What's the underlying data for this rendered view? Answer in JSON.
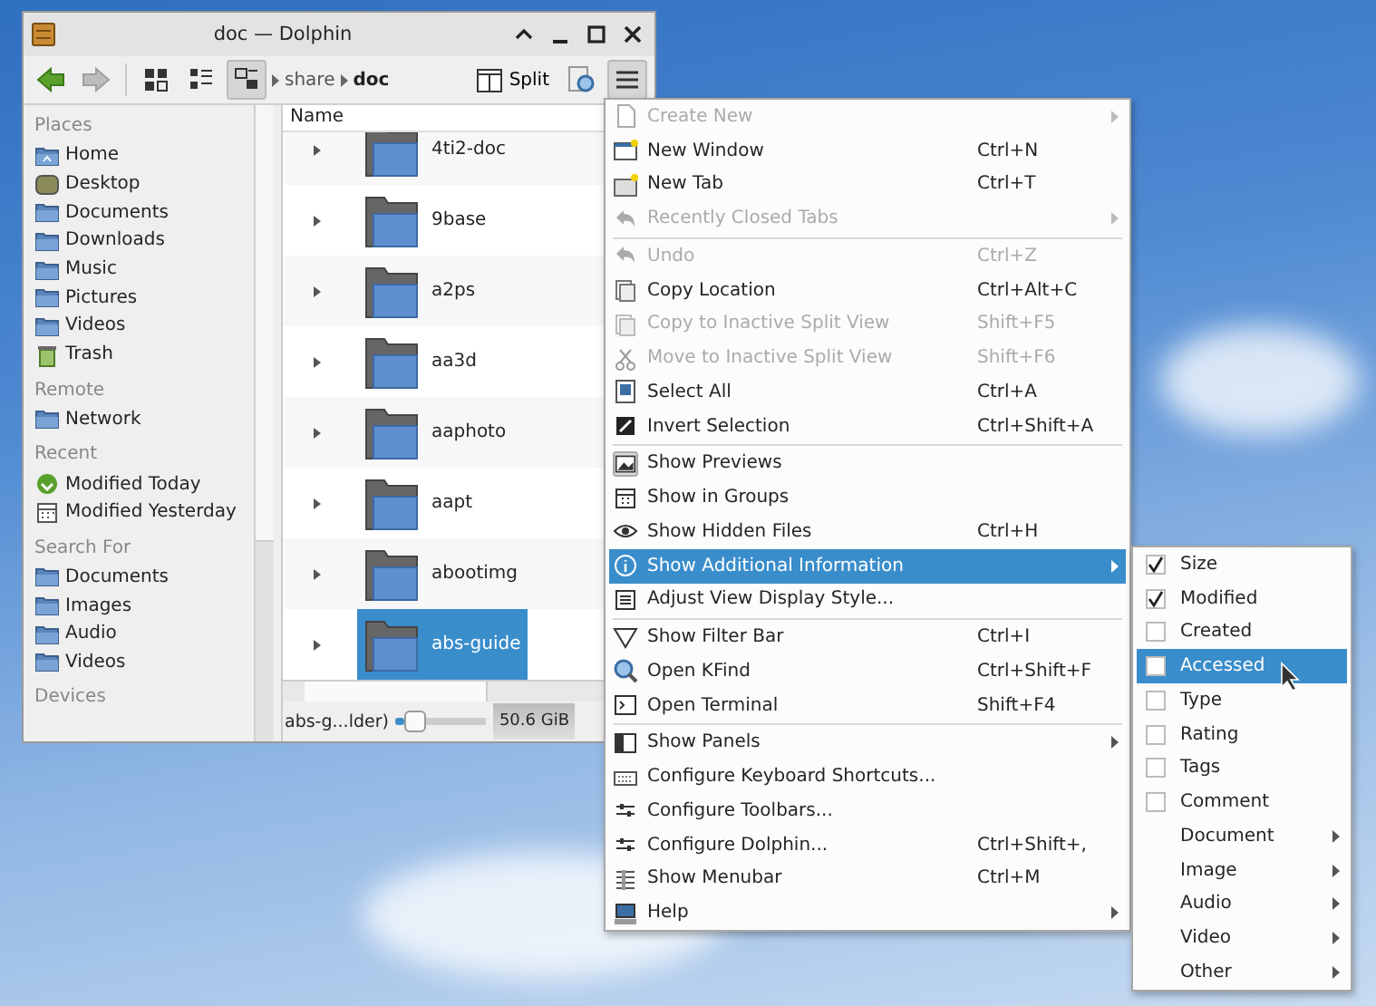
{
  "window": {
    "title": "doc — Dolphin"
  },
  "toolbar": {
    "breadcrumb": [
      {
        "label": "share",
        "current": false
      },
      {
        "label": "doc",
        "current": true
      }
    ],
    "split_button": "Split"
  },
  "sidebar": {
    "sections": [
      {
        "title": "Places",
        "items": [
          "Home",
          "Desktop",
          "Documents",
          "Downloads",
          "Music",
          "Pictures",
          "Videos",
          "Trash"
        ]
      },
      {
        "title": "Remote",
        "items": [
          "Network"
        ]
      },
      {
        "title": "Recent",
        "items": [
          "Modified Today",
          "Modified Yesterday"
        ]
      },
      {
        "title": "Search For",
        "items": [
          "Documents",
          "Images",
          "Audio",
          "Videos"
        ]
      },
      {
        "title": "Devices"
      }
    ]
  },
  "file_view": {
    "column": "Name",
    "rows": [
      {
        "name": "4ti2-doc",
        "selected": false
      },
      {
        "name": "9base",
        "selected": false
      },
      {
        "name": "a2ps",
        "selected": false
      },
      {
        "name": "aa3d",
        "selected": false
      },
      {
        "name": "aaphoto",
        "selected": false
      },
      {
        "name": "aapt",
        "selected": false
      },
      {
        "name": "abootimg",
        "selected": false
      },
      {
        "name": "abs-guide",
        "selected": true
      }
    ]
  },
  "status_bar": {
    "selection": "abs-g...lder)",
    "zoom": {
      "level": 0.1
    },
    "free_space": "50.6 GiB"
  },
  "menu": {
    "items": [
      {
        "kind": "item",
        "label": "Create New",
        "disabled": true,
        "submenu": true,
        "selected": false
      },
      {
        "kind": "item",
        "label": "New Window",
        "shortcut": "Ctrl+N",
        "disabled": false,
        "submenu": false,
        "selected": false
      },
      {
        "kind": "item",
        "label": "New Tab",
        "shortcut": "Ctrl+T",
        "disabled": false,
        "submenu": false,
        "selected": false
      },
      {
        "kind": "item",
        "label": "Recently Closed Tabs",
        "disabled": true,
        "submenu": true,
        "selected": false
      },
      {
        "kind": "separator"
      },
      {
        "kind": "item",
        "label": "Undo",
        "shortcut": "Ctrl+Z",
        "disabled": true,
        "submenu": false,
        "selected": false
      },
      {
        "kind": "item",
        "label": "Copy Location",
        "shortcut": "Ctrl+Alt+C",
        "disabled": false,
        "submenu": false,
        "selected": false
      },
      {
        "kind": "item",
        "label": "Copy to Inactive Split View",
        "shortcut": "Shift+F5",
        "disabled": true,
        "submenu": false,
        "selected": false
      },
      {
        "kind": "item",
        "label": "Move to Inactive Split View",
        "shortcut": "Shift+F6",
        "disabled": true,
        "submenu": false,
        "selected": false
      },
      {
        "kind": "item",
        "label": "Select All",
        "shortcut": "Ctrl+A",
        "disabled": false,
        "submenu": false,
        "selected": false
      },
      {
        "kind": "item",
        "label": "Invert Selection",
        "shortcut": "Ctrl+Shift+A",
        "disabled": false,
        "submenu": false,
        "selected": false
      },
      {
        "kind": "separator"
      },
      {
        "kind": "toggle",
        "label": "Show Previews",
        "checked": true,
        "disabled": false,
        "submenu": false,
        "selected": false
      },
      {
        "kind": "toggle",
        "label": "Show in Groups",
        "checked": false,
        "disabled": false,
        "submenu": false,
        "selected": false
      },
      {
        "kind": "toggle",
        "label": "Show Hidden Files",
        "shortcut": "Ctrl+H",
        "checked": false,
        "disabled": false,
        "submenu": false,
        "selected": false
      },
      {
        "kind": "item",
        "label": "Show Additional Information",
        "disabled": false,
        "submenu": true,
        "selected": true
      },
      {
        "kind": "item",
        "label": "Adjust View Display Style...",
        "disabled": false,
        "submenu": false,
        "selected": false
      },
      {
        "kind": "separator"
      },
      {
        "kind": "item",
        "label": "Show Filter Bar",
        "shortcut": "Ctrl+I",
        "disabled": false,
        "submenu": false,
        "selected": false
      },
      {
        "kind": "item",
        "label": "Open KFind",
        "shortcut": "Ctrl+Shift+F",
        "disabled": false,
        "submenu": false,
        "selected": false
      },
      {
        "kind": "item",
        "label": "Open Terminal",
        "shortcut": "Shift+F4",
        "disabled": false,
        "submenu": false,
        "selected": false
      },
      {
        "kind": "separator"
      },
      {
        "kind": "item",
        "label": "Show Panels",
        "disabled": false,
        "submenu": true,
        "selected": false
      },
      {
        "kind": "item",
        "label": "Configure Keyboard Shortcuts...",
        "disabled": false,
        "submenu": false,
        "selected": false
      },
      {
        "kind": "item",
        "label": "Configure Toolbars...",
        "disabled": false,
        "submenu": false,
        "selected": false
      },
      {
        "kind": "item",
        "label": "Configure Dolphin...",
        "shortcut": "Ctrl+Shift+,",
        "disabled": false,
        "submenu": false,
        "selected": false
      },
      {
        "kind": "item",
        "label": "Show Menubar",
        "shortcut": "Ctrl+M",
        "disabled": false,
        "submenu": false,
        "selected": false
      },
      {
        "kind": "item",
        "label": "Help",
        "disabled": false,
        "submenu": true,
        "selected": false
      }
    ]
  },
  "submenu": {
    "items": [
      {
        "kind": "check",
        "label": "Size",
        "checked": true,
        "selected": false
      },
      {
        "kind": "check",
        "label": "Modified",
        "checked": true,
        "selected": false
      },
      {
        "kind": "check",
        "label": "Created",
        "checked": false,
        "selected": false
      },
      {
        "kind": "check",
        "label": "Accessed",
        "checked": false,
        "selected": true
      },
      {
        "kind": "check",
        "label": "Type",
        "checked": false,
        "selected": false
      },
      {
        "kind": "check",
        "label": "Rating",
        "checked": false,
        "selected": false
      },
      {
        "kind": "check",
        "label": "Tags",
        "checked": false,
        "selected": false
      },
      {
        "kind": "check",
        "label": "Comment",
        "checked": false,
        "selected": false
      },
      {
        "kind": "submenu",
        "label": "Document",
        "selected": false
      },
      {
        "kind": "submenu",
        "label": "Image",
        "selected": false
      },
      {
        "kind": "submenu",
        "label": "Audio",
        "selected": false
      },
      {
        "kind": "submenu",
        "label": "Video",
        "selected": false
      },
      {
        "kind": "submenu",
        "label": "Other",
        "selected": false
      }
    ]
  }
}
